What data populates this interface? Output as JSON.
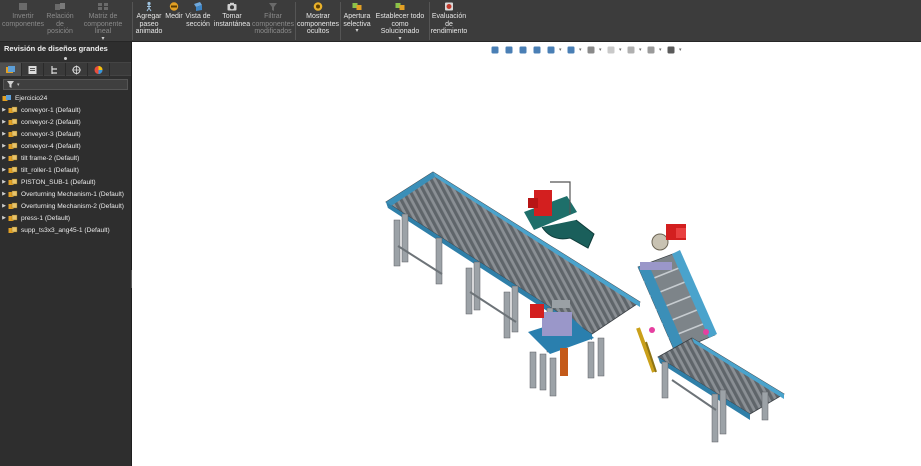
{
  "ribbon": {
    "buttons": [
      {
        "label": "Invertir componentes",
        "icon": "invert-components-icon",
        "disabled": true
      },
      {
        "label": "Relación de posición",
        "icon": "mate-icon",
        "disabled": true
      },
      {
        "label": "Matriz de componente lineal",
        "icon": "linear-pattern-icon",
        "disabled": true
      },
      {
        "label": "Agregar paseo animado",
        "icon": "walkthrough-icon",
        "disabled": false
      },
      {
        "label": "Medir",
        "icon": "measure-icon",
        "disabled": false
      },
      {
        "label": "Vista de sección",
        "icon": "section-view-icon",
        "disabled": false
      },
      {
        "label": "Tomar instantánea",
        "icon": "snapshot-camera-icon",
        "disabled": false
      },
      {
        "label": "Filtrar componentes modificados",
        "icon": "filter-modified-icon",
        "disabled": true
      },
      {
        "label": "Mostrar componentes ocultos",
        "icon": "show-hidden-icon",
        "disabled": false
      },
      {
        "label": "Apertura selectiva",
        "icon": "selective-open-icon",
        "disabled": false
      },
      {
        "label": "Establecer todo como Solucionado",
        "icon": "set-resolved-icon",
        "disabled": false
      },
      {
        "label": "Evaluación de rendimiento",
        "icon": "performance-icon",
        "disabled": false
      }
    ]
  },
  "panel": {
    "title": "Revisión de diseños grandes",
    "tabs": [
      "feature-manager-icon",
      "property-manager-icon",
      "configuration-manager-icon",
      "dimxpert-icon",
      "display-manager-icon"
    ],
    "root": "Ejercicio24",
    "items": [
      {
        "label": "conveyor-1 (Default)"
      },
      {
        "label": "conveyor-2 (Default)"
      },
      {
        "label": "conveyor-3 (Default)"
      },
      {
        "label": "conveyor-4 (Default)"
      },
      {
        "label": "tilt frame-2 (Default)"
      },
      {
        "label": "tilt_roller-1 (Default)"
      },
      {
        "label": "PISTON_SUB-1 (Default)"
      },
      {
        "label": "Overturning Mechanism-1 (Default)"
      },
      {
        "label": "Overturning Mechanism-2 (Default)"
      },
      {
        "label": "press-1 (Default)"
      },
      {
        "label": "supp_ts3x3_ang45-1 (Default)"
      }
    ]
  },
  "hud": {
    "icons": [
      "zoom-to-fit-icon",
      "zoom-to-area-icon",
      "previous-view-icon",
      "section-view-icon",
      "view-orientation-icon",
      "display-style-icon",
      "hide-show-items-icon",
      "edit-appearance-icon",
      "apply-scene-icon",
      "view-settings-icon",
      "display-monitor-icon"
    ]
  }
}
